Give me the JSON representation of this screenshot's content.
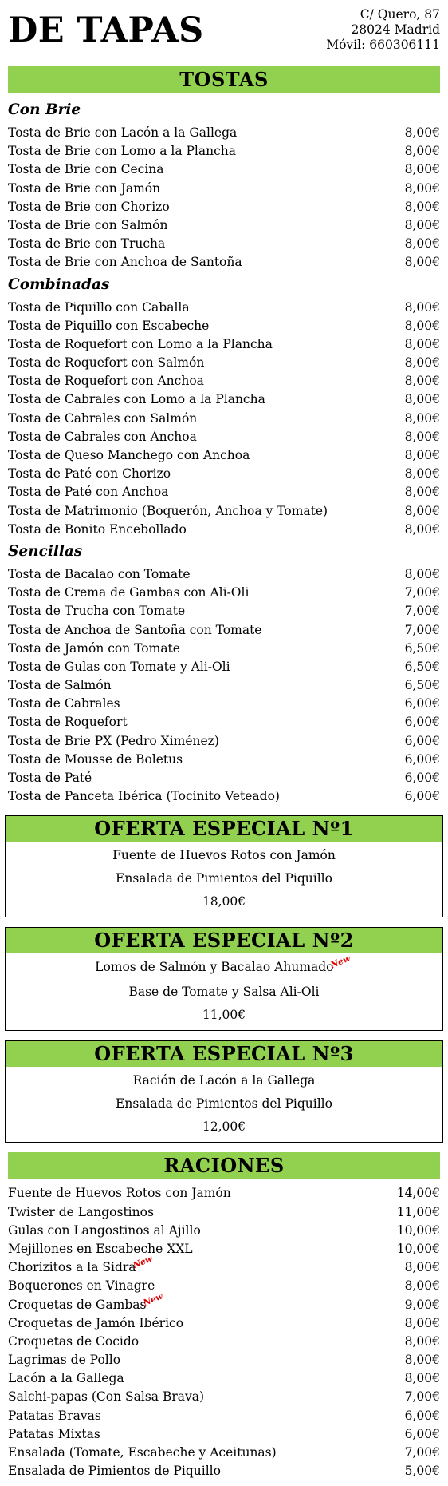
{
  "header": {
    "title": "DE TAPAS",
    "address_line1": "C/ Quero, 87",
    "address_line2": "28024 Madrid",
    "phone": "Móvil: 660306111"
  },
  "colors": {
    "accent": "#92d050",
    "new_badge": "#e00000"
  },
  "new_label": "New",
  "tostas": {
    "title": "TOSTAS",
    "con_brie": {
      "title": "Con Brie",
      "items": [
        {
          "name": "Tosta de Brie con Lacón a la Gallega",
          "price": "8,00€"
        },
        {
          "name": "Tosta de Brie con Lomo a la Plancha",
          "price": "8,00€"
        },
        {
          "name": "Tosta de Brie con Cecina",
          "price": "8,00€"
        },
        {
          "name": "Tosta de Brie con Jamón",
          "price": "8,00€"
        },
        {
          "name": "Tosta de Brie con Chorizo",
          "price": "8,00€"
        },
        {
          "name": "Tosta de Brie con Salmón",
          "price": "8,00€"
        },
        {
          "name": "Tosta de Brie con Trucha",
          "price": "8,00€"
        },
        {
          "name": "Tosta de Brie con Anchoa de Santoña",
          "price": "8,00€"
        }
      ]
    },
    "combinadas": {
      "title": "Combinadas",
      "items": [
        {
          "name": "Tosta de Piquillo con Caballa",
          "price": "8,00€"
        },
        {
          "name": "Tosta de Piquillo con Escabeche",
          "price": "8,00€"
        },
        {
          "name": "Tosta de Roquefort con Lomo a la Plancha",
          "price": "8,00€"
        },
        {
          "name": "Tosta de Roquefort con Salmón",
          "price": "8,00€"
        },
        {
          "name": "Tosta de Roquefort con Anchoa",
          "price": "8,00€"
        },
        {
          "name": "Tosta de Cabrales con Lomo a la Plancha",
          "price": "8,00€"
        },
        {
          "name": "Tosta de Cabrales con Salmón",
          "price": "8,00€"
        },
        {
          "name": "Tosta de Cabrales con Anchoa",
          "price": "8,00€"
        },
        {
          "name": "Tosta de Queso Manchego con Anchoa",
          "price": "8,00€"
        },
        {
          "name": "Tosta de Paté con Chorizo",
          "price": "8,00€"
        },
        {
          "name": "Tosta de Paté con Anchoa",
          "price": "8,00€"
        },
        {
          "name": "Tosta de Matrimonio (Boquerón, Anchoa y Tomate)",
          "price": "8,00€"
        },
        {
          "name": "Tosta de Bonito Encebollado",
          "price": "8,00€"
        }
      ]
    },
    "sencillas": {
      "title": "Sencillas",
      "items": [
        {
          "name": "Tosta de Bacalao con Tomate",
          "price": "8,00€"
        },
        {
          "name": "Tosta de Crema de Gambas con Ali-Oli",
          "price": "7,00€"
        },
        {
          "name": "Tosta de Trucha con Tomate",
          "price": "7,00€"
        },
        {
          "name": "Tosta de Anchoa de Santoña con Tomate",
          "price": "7,00€"
        },
        {
          "name": "Tosta de Jamón con Tomate",
          "price": "6,50€"
        },
        {
          "name": "Tosta de Gulas con Tomate y Ali-Oli",
          "price": "6,50€"
        },
        {
          "name": "Tosta de Salmón",
          "price": "6,50€"
        },
        {
          "name": "Tosta de Cabrales",
          "price": "6,00€"
        },
        {
          "name": "Tosta de Roquefort",
          "price": "6,00€"
        },
        {
          "name": "Tosta de Brie PX (Pedro Ximénez)",
          "price": "6,00€"
        },
        {
          "name": "Tosta de Mousse de Boletus",
          "price": "6,00€"
        },
        {
          "name": "Tosta de Paté",
          "price": "6,00€"
        },
        {
          "name": "Tosta de Panceta Ibérica (Tocinito Veteado)",
          "price": "6,00€"
        }
      ]
    }
  },
  "offers": [
    {
      "title": "OFERTA ESPECIAL Nº1",
      "line1": "Fuente de Huevos Rotos con Jamón",
      "line2": "Ensalada de Pimientos del Piquillo",
      "price": "18,00€"
    },
    {
      "title": "OFERTA ESPECIAL Nº2",
      "line1": "Lomos de Salmón y Bacalao Ahumado",
      "line2": "Base de Tomate y Salsa Ali-Oli",
      "price": "11,00€"
    },
    {
      "title": "OFERTA ESPECIAL Nº3",
      "line1": "Ración de Lacón a la Gallega",
      "line2": "Ensalada de Pimientos del Piquillo",
      "price": "12,00€"
    }
  ],
  "raciones": {
    "title": "RACIONES",
    "items": [
      {
        "name": "Fuente de Huevos Rotos con Jamón",
        "price": "14,00€"
      },
      {
        "name": "Twister de Langostinos",
        "price": "11,00€"
      },
      {
        "name": "Gulas con Langostinos al Ajillo",
        "price": "10,00€"
      },
      {
        "name": "Mejillones en Escabeche XXL",
        "price": "10,00€"
      },
      {
        "name": "Chorizitos a la Sidra",
        "price": "8,00€"
      },
      {
        "name": "Boquerones en Vinagre",
        "price": "8,00€"
      },
      {
        "name": "Croquetas de Gambas",
        "price": "9,00€"
      },
      {
        "name": "Croquetas de Jamón Ibérico",
        "price": "8,00€"
      },
      {
        "name": "Croquetas de Cocido",
        "price": "8,00€"
      },
      {
        "name": "Lagrimas de Pollo",
        "price": "8,00€"
      },
      {
        "name": "Lacón a la Gallega",
        "price": "8,00€"
      },
      {
        "name": "Salchi-papas (Con Salsa Brava)",
        "price": "7,00€"
      },
      {
        "name": "Patatas Bravas",
        "price": "6,00€"
      },
      {
        "name": "Patatas Mixtas",
        "price": "6,00€"
      },
      {
        "name": "Ensalada (Tomate, Escabeche y Aceitunas)",
        "price": "7,00€"
      },
      {
        "name": "Ensalada de Pimientos de Piquillo",
        "price": "5,00€"
      }
    ]
  }
}
